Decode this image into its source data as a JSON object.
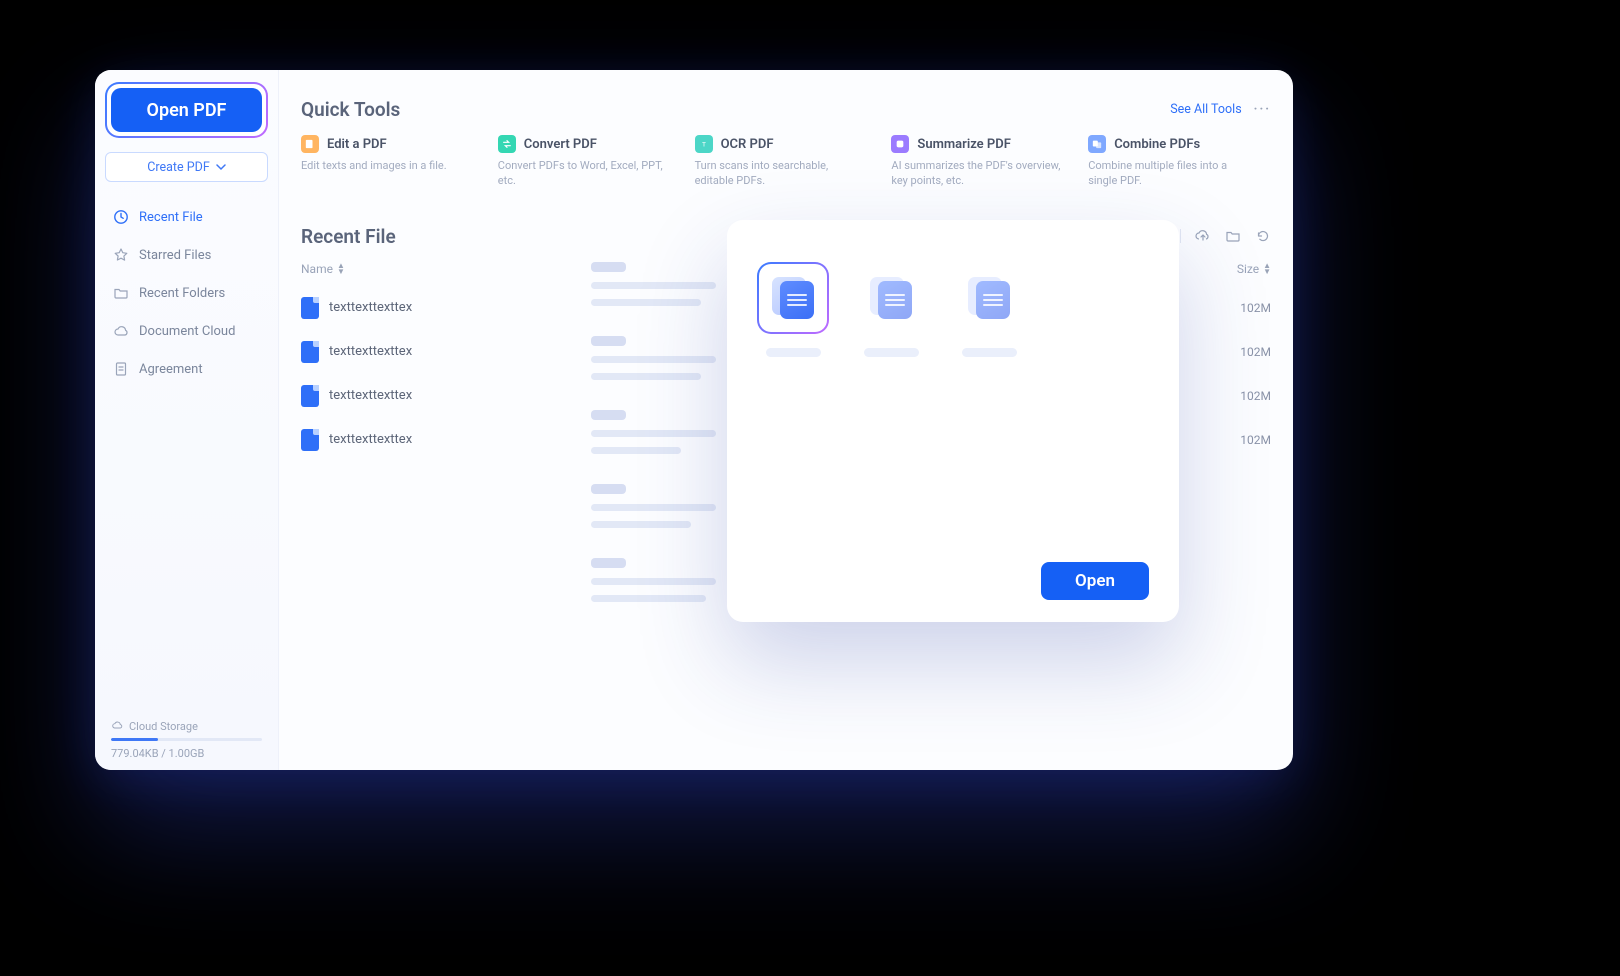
{
  "sidebar": {
    "open_pdf_label": "Open PDF",
    "create_pdf_label": "Create PDF",
    "items": [
      {
        "label": "Recent File",
        "icon": "clock"
      },
      {
        "label": "Starred Files",
        "icon": "star"
      },
      {
        "label": "Recent Folders",
        "icon": "folder"
      },
      {
        "label": "Document Cloud",
        "icon": "cloud"
      },
      {
        "label": "Agreement",
        "icon": "doc"
      }
    ],
    "cloud_storage_label": "Cloud Storage",
    "storage_text": "779.04KB / 1.00GB"
  },
  "quick_tools": {
    "heading": "Quick Tools",
    "see_all_label": "See All Tools",
    "tools": [
      {
        "title": "Edit a PDF",
        "desc": "Edit texts and images in a file.",
        "color": "#ffb561"
      },
      {
        "title": "Convert PDF",
        "desc": "Convert PDFs to Word, Excel, PPT, etc.",
        "color": "#34d7b3"
      },
      {
        "title": "OCR PDF",
        "desc": "Turn scans into searchable, editable PDFs.",
        "color": "#4cd6c7"
      },
      {
        "title": "Summarize PDF",
        "desc": "AI summarizes the PDF's overview, key points, etc.",
        "color": "#9b7bff"
      },
      {
        "title": "Combine PDFs",
        "desc": "Combine multiple files into a single PDF.",
        "color": "#7fa8ff"
      }
    ]
  },
  "recent": {
    "heading": "Recent File",
    "name_col": "Name",
    "size_col": "Size",
    "rows": [
      {
        "name": "texttexttexttex",
        "size": "102M"
      },
      {
        "name": "texttexttexttex",
        "size": "102M"
      },
      {
        "name": "texttexttexttex",
        "size": "102M"
      },
      {
        "name": "texttexttexttex",
        "size": "102M"
      }
    ]
  },
  "dialog": {
    "open_label": "Open"
  }
}
